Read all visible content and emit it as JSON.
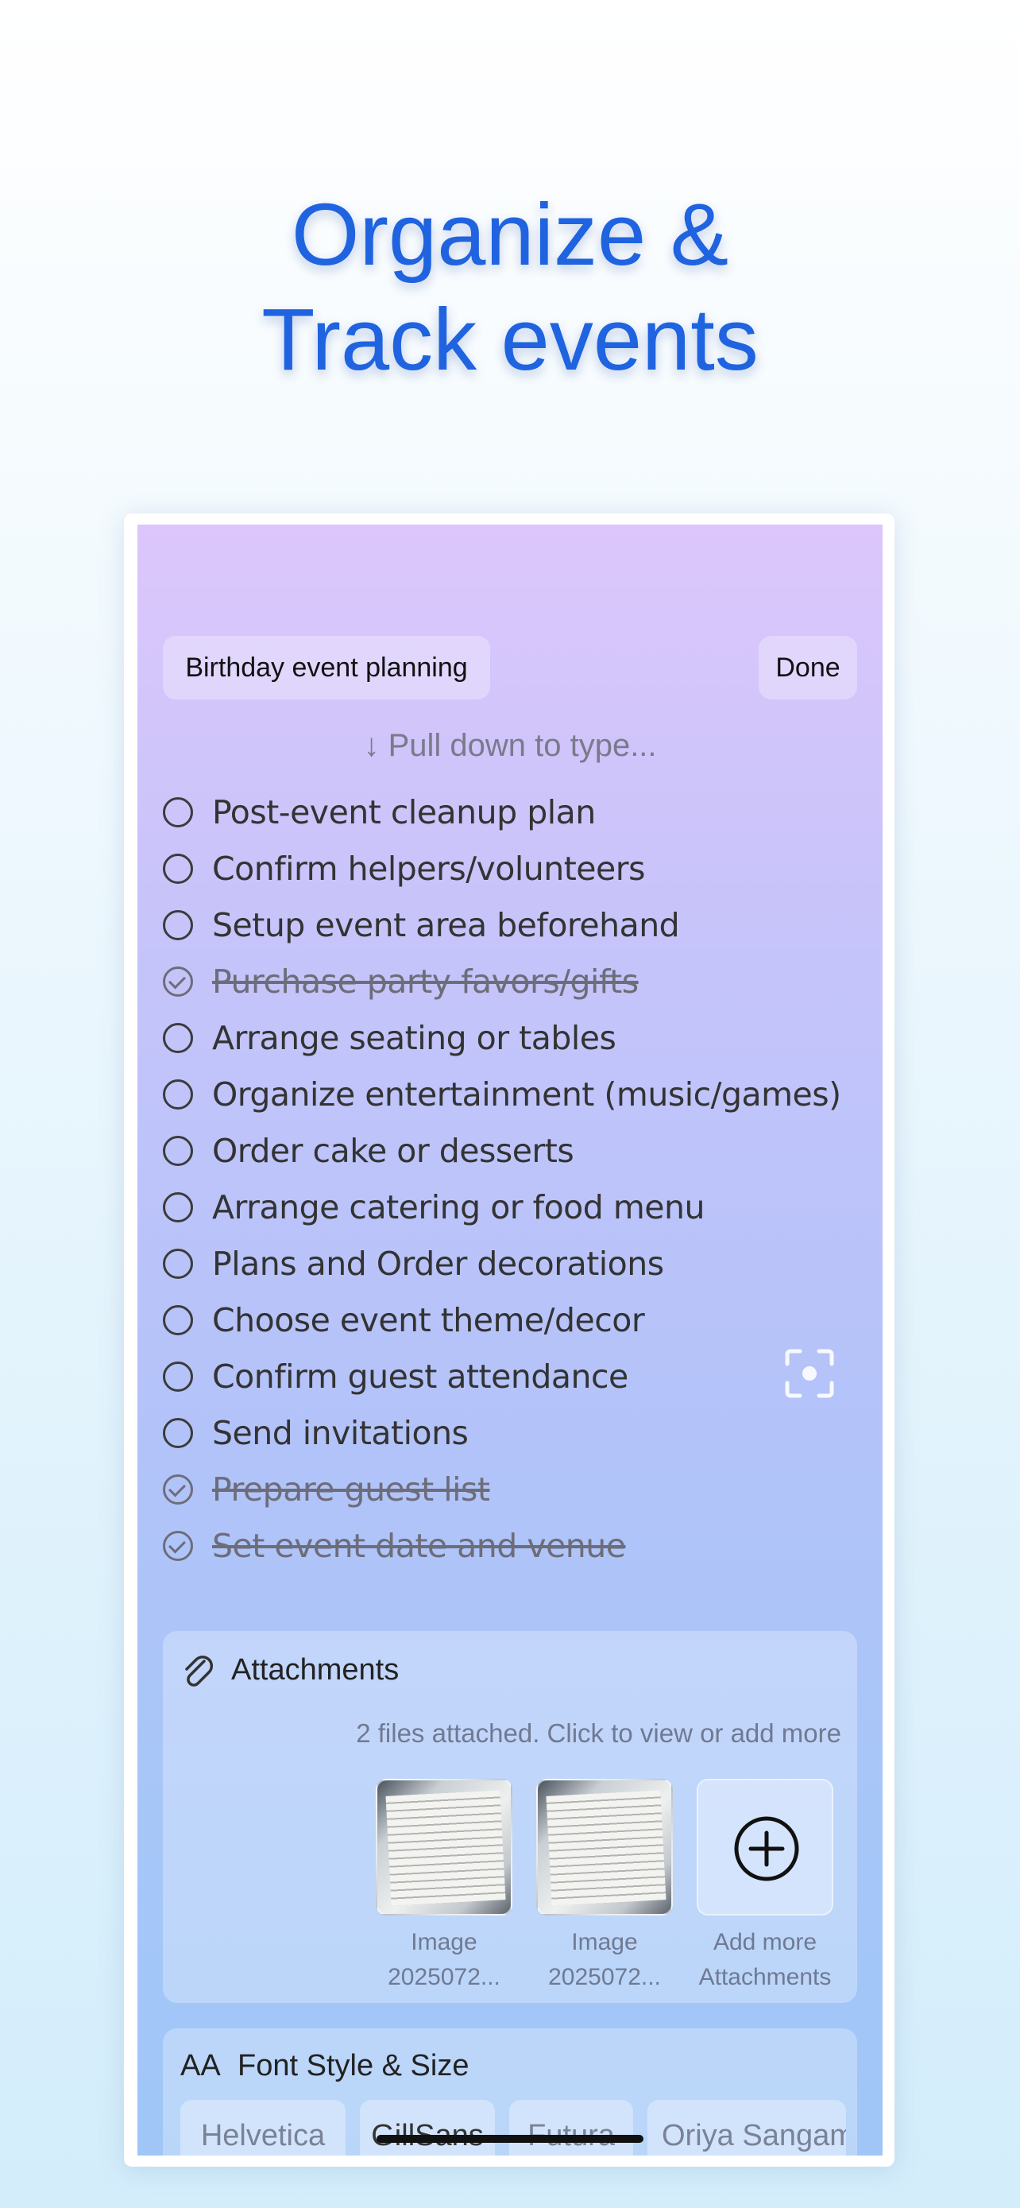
{
  "headline": {
    "line1": "Organize &",
    "line2": "Track events"
  },
  "note": {
    "title": "Birthday event planning",
    "done_label": "Done",
    "pull_hint": "↓ Pull down to type..."
  },
  "checklist": [
    {
      "label": "Post-event cleanup plan",
      "checked": false
    },
    {
      "label": "Confirm helpers/volunteers",
      "checked": false
    },
    {
      "label": "Setup event area beforehand",
      "checked": false
    },
    {
      "label": "Purchase party favors/gifts",
      "checked": true
    },
    {
      "label": "Arrange seating or tables",
      "checked": false
    },
    {
      "label": "Organize entertainment (music/games)",
      "checked": false
    },
    {
      "label": "Order cake or desserts",
      "checked": false
    },
    {
      "label": "Arrange catering or food menu",
      "checked": false
    },
    {
      "label": "Plans and Order decorations",
      "checked": false
    },
    {
      "label": "Choose event theme/decor",
      "checked": false
    },
    {
      "label": "Confirm guest attendance",
      "checked": false
    },
    {
      "label": "Send invitations",
      "checked": false
    },
    {
      "label": "Prepare guest list",
      "checked": true
    },
    {
      "label": "Set event date and venue",
      "checked": true
    }
  ],
  "attachments": {
    "title": "Attachments",
    "summary": "2 files attached. Click to view or add more",
    "files": [
      {
        "line1": "Image",
        "line2": "2025072..."
      },
      {
        "line1": "Image",
        "line2": "2025072..."
      }
    ],
    "add_label_1": "Add more",
    "add_label_2": "Attachments"
  },
  "font_style": {
    "icon_text": "AA",
    "title": "Font Style & Size",
    "options": [
      "Helvetica",
      "GillSans",
      "Futura",
      "Oriya Sangam"
    ]
  }
}
